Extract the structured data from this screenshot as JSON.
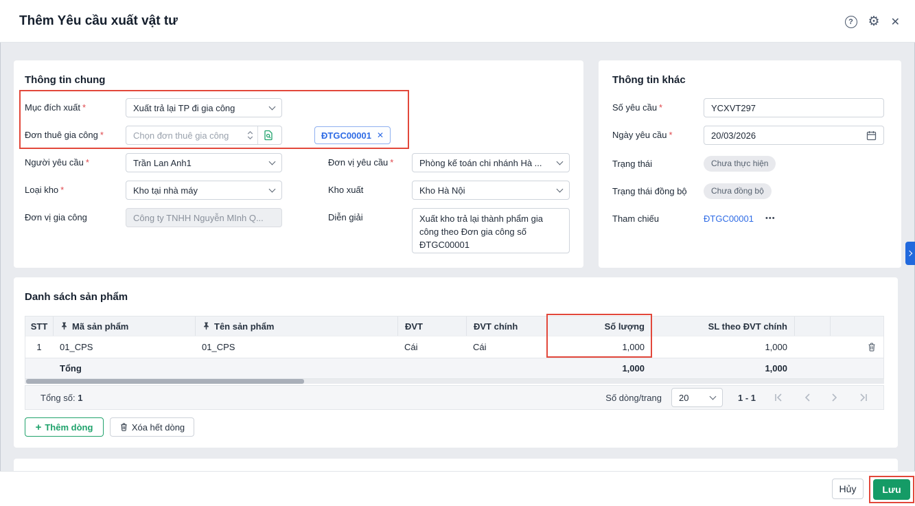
{
  "window": {
    "title": "Thêm Yêu cầu xuất vật tư"
  },
  "icons": {
    "help": "?",
    "gear": "⚙",
    "close": "✕",
    "chip_remove": "✕",
    "more": "•••",
    "plus": "+"
  },
  "required_marker": "*",
  "colors": {
    "primary_green": "#159b66",
    "link_blue": "#2e6be5",
    "annotation_red": "#e2473a",
    "badge_bg": "#e8e9ed"
  },
  "general": {
    "section_title": "Thông tin chung",
    "muc_dich_xuat_label": "Mục đích xuất",
    "muc_dich_xuat_value": "Xuất trả lại TP đi gia công",
    "don_thue_label": "Đơn thuê gia công",
    "don_thue_placeholder": "Chọn đơn thuê gia công",
    "don_thue_chip": "ĐTGC00001",
    "nguoi_yeu_cau_label": "Người yêu cầu",
    "nguoi_yeu_cau_value": "Trần Lan Anh1",
    "don_vi_yeu_cau_label": "Đơn vị yêu cầu",
    "don_vi_yeu_cau_value": "Phòng kế toán chi nhánh Hà ...",
    "loai_kho_label": "Loại kho",
    "loai_kho_value": "Kho tại nhà máy",
    "kho_xuat_label": "Kho xuất",
    "kho_xuat_value": "Kho Hà Nội",
    "don_vi_gia_cong_label": "Đơn vị gia công",
    "don_vi_gia_cong_value": "Công ty TNHH Nguyễn MInh Q...",
    "dien_giai_label": "Diễn giải",
    "dien_giai_value": "Xuất kho trả lại thành phẩm gia công theo Đơn gia công số ĐTGC00001"
  },
  "other": {
    "section_title": "Thông tin khác",
    "so_yeu_cau_label": "Số yêu cầu",
    "so_yeu_cau_value": "YCXVT297",
    "ngay_yeu_cau_label": "Ngày yêu cầu",
    "ngay_yeu_cau_value": "20/03/2026",
    "trang_thai_label": "Trạng thái",
    "trang_thai_value": "Chưa thực hiện",
    "dong_bo_label": "Trạng thái đồng bộ",
    "dong_bo_value": "Chưa đồng bộ",
    "tham_chieu_label": "Tham chiếu",
    "tham_chieu_value": "ĐTGC00001"
  },
  "products": {
    "section_title": "Danh sách sản phẩm",
    "columns": [
      "STT",
      "Mã sản phẩm",
      "Tên sản phẩm",
      "ĐVT",
      "ĐVT chính",
      "Số lượng",
      "SL theo ĐVT chính"
    ],
    "rows": [
      [
        "1",
        "01_CPS",
        "01_CPS",
        "Cái",
        "Cái",
        "1,000",
        "1,000"
      ]
    ],
    "total_label": "Tổng",
    "total_so_luong": "1,000",
    "total_sl_chinh": "1,000",
    "summary_label": "Tổng số:",
    "summary_value": "1",
    "page_size_label": "Số dòng/trang",
    "page_size_value": "20",
    "page_range": "1 - 1",
    "add_row_label": "Thêm dòng",
    "delete_all_label": "Xóa hết dòng"
  },
  "footer": {
    "cancel_label": "Hủy",
    "save_label": "Lưu"
  }
}
